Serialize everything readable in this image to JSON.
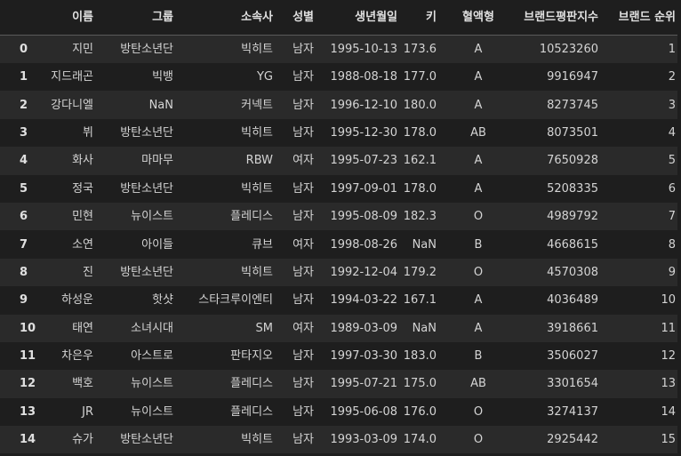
{
  "columns": [
    "",
    "이름",
    "그룹",
    "소속사",
    "성별",
    "생년월일",
    "키",
    "혈액형",
    "브랜드평판지수",
    "브랜드 순위"
  ],
  "rows": [
    [
      "0",
      "지민",
      "방탄소년단",
      "빅히트",
      "남자",
      "1995-10-13",
      "173.6",
      "A",
      "10523260",
      "1"
    ],
    [
      "1",
      "지드래곤",
      "빅뱅",
      "YG",
      "남자",
      "1988-08-18",
      "177.0",
      "A",
      "9916947",
      "2"
    ],
    [
      "2",
      "강다니엘",
      "NaN",
      "커넥트",
      "남자",
      "1996-12-10",
      "180.0",
      "A",
      "8273745",
      "3"
    ],
    [
      "3",
      "뷔",
      "방탄소년단",
      "빅히트",
      "남자",
      "1995-12-30",
      "178.0",
      "AB",
      "8073501",
      "4"
    ],
    [
      "4",
      "화사",
      "마마무",
      "RBW",
      "여자",
      "1995-07-23",
      "162.1",
      "A",
      "7650928",
      "5"
    ],
    [
      "5",
      "정국",
      "방탄소년단",
      "빅히트",
      "남자",
      "1997-09-01",
      "178.0",
      "A",
      "5208335",
      "6"
    ],
    [
      "6",
      "민현",
      "뉴이스트",
      "플레디스",
      "남자",
      "1995-08-09",
      "182.3",
      "O",
      "4989792",
      "7"
    ],
    [
      "7",
      "소연",
      "아이들",
      "큐브",
      "여자",
      "1998-08-26",
      "NaN",
      "B",
      "4668615",
      "8"
    ],
    [
      "8",
      "진",
      "방탄소년단",
      "빅히트",
      "남자",
      "1992-12-04",
      "179.2",
      "O",
      "4570308",
      "9"
    ],
    [
      "9",
      "하성운",
      "핫샷",
      "스타크루이엔티",
      "남자",
      "1994-03-22",
      "167.1",
      "A",
      "4036489",
      "10"
    ],
    [
      "10",
      "태연",
      "소녀시대",
      "SM",
      "여자",
      "1989-03-09",
      "NaN",
      "A",
      "3918661",
      "11"
    ],
    [
      "11",
      "차은우",
      "아스트로",
      "판타지오",
      "남자",
      "1997-03-30",
      "183.0",
      "B",
      "3506027",
      "12"
    ],
    [
      "12",
      "백호",
      "뉴이스트",
      "플레디스",
      "남자",
      "1995-07-21",
      "175.0",
      "AB",
      "3301654",
      "13"
    ],
    [
      "13",
      "JR",
      "뉴이스트",
      "플레디스",
      "남자",
      "1995-06-08",
      "176.0",
      "O",
      "3274137",
      "14"
    ],
    [
      "14",
      "슈가",
      "방탄소년단",
      "빅히트",
      "남자",
      "1993-03-09",
      "174.0",
      "O",
      "2925442",
      "15"
    ]
  ]
}
